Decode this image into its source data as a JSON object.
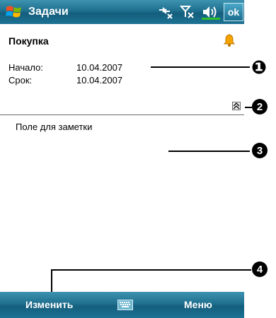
{
  "title_bar": {
    "title": "Задачи",
    "ok_label": "ok",
    "status_icons": [
      "connectivity-icon",
      "signal-off-icon",
      "speaker-icon"
    ]
  },
  "task": {
    "name": "Покупка",
    "start_label": "Начало:",
    "start_value": "10.04.2007",
    "due_label": "Срок:",
    "due_value": "10.04.2007",
    "note_placeholder": "Поле для заметки"
  },
  "callouts": [
    "❶",
    "2",
    "3",
    "4"
  ],
  "menu_bar": {
    "left_label": "Изменить",
    "right_label": "Меню",
    "keyboard_icon": "keyboard-icon"
  },
  "colors": {
    "bar_blue": "#1f6f8f",
    "bell_orange": "#f4a300",
    "signal_green": "#2ec02e"
  }
}
